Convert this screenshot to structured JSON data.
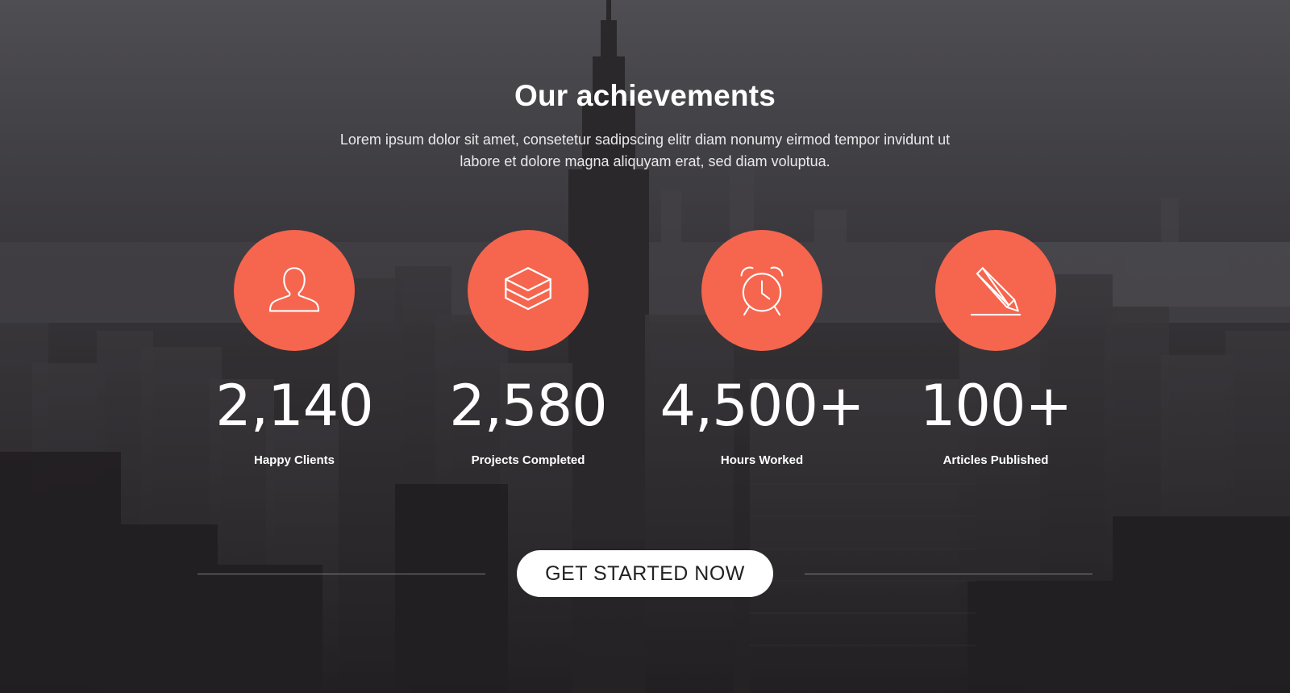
{
  "section": {
    "title": "Our achievements",
    "subtitle_line1": "Lorem ipsum dolor sit amet, consetetur sadipscing elitr diam nonumy eirmod tempor invidunt ut",
    "subtitle_line2": "labore et dolore magna aliquyam erat, sed diam voluptua."
  },
  "stats": [
    {
      "value": "2,140",
      "label": "Happy Clients",
      "icon": "user-icon"
    },
    {
      "value": "2,580",
      "label": "Projects Completed",
      "icon": "layers-icon"
    },
    {
      "value": "4,500+",
      "label": "Hours Worked",
      "icon": "alarm-clock-icon"
    },
    {
      "value": "100+",
      "label": "Articles Published",
      "icon": "pencil-icon"
    }
  ],
  "cta": {
    "label": "GET STARTED NOW"
  },
  "colors": {
    "accent": "#f6654e",
    "text": "#ffffff",
    "button_bg": "#ffffff",
    "button_text": "#222222"
  }
}
